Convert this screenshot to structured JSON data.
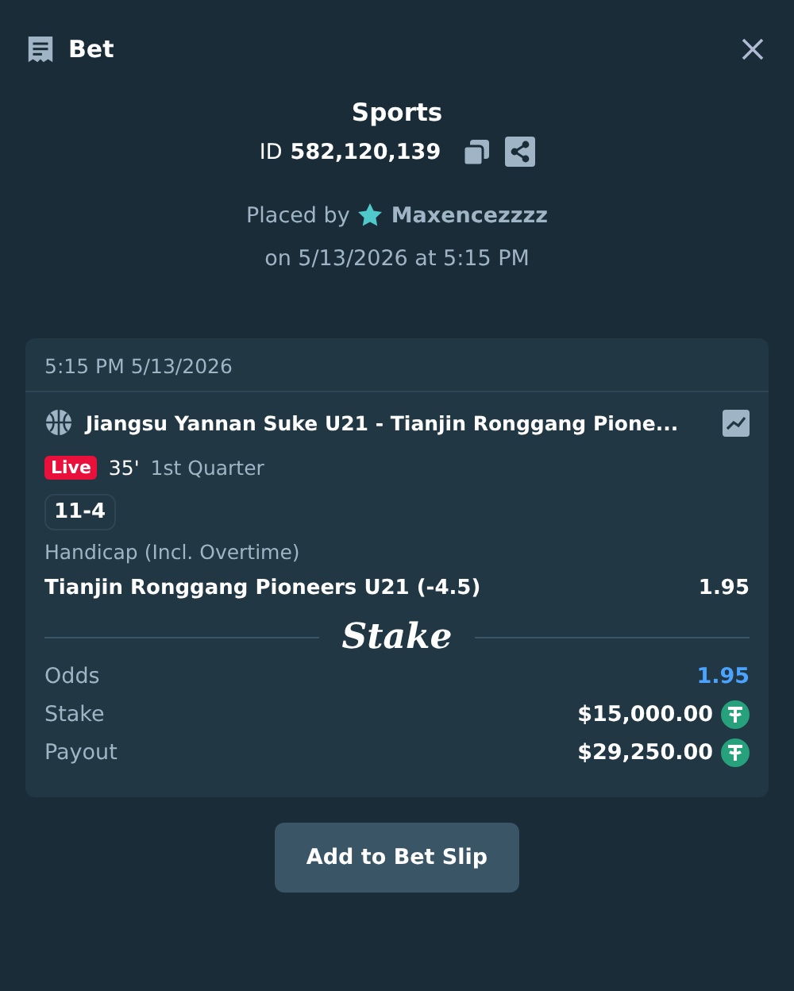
{
  "header": {
    "title": "Bet"
  },
  "summary": {
    "category": "Sports",
    "id_label": "ID",
    "id_value": "582,120,139",
    "placed_by": "Placed by",
    "user": "Maxencezzzz",
    "placed_on": "on 5/13/2026 at 5:15 PM"
  },
  "card": {
    "timestamp": "5:15 PM 5/13/2026",
    "event": "Jiangsu Yannan Suke U21 - Tianjin Ronggang Pione...",
    "live_badge": "Live",
    "minute": "35'",
    "period": "1st Quarter",
    "score": "11-4",
    "market": "Handicap (Incl. Overtime)",
    "selection": "Tianjin Ronggang Pioneers U21 (-4.5)",
    "selection_odds": "1.95",
    "brand": "Stake",
    "details": [
      {
        "kind": "odds",
        "label": "Odds",
        "value": "1.95"
      },
      {
        "kind": "amount",
        "label": "Stake",
        "value": "$15,000.00"
      },
      {
        "kind": "amount",
        "label": "Payout",
        "value": "$29,250.00"
      }
    ]
  },
  "button": "Add to Bet Slip"
}
